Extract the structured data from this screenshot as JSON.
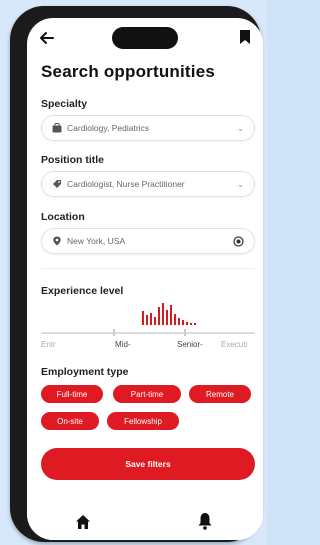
{
  "header": {
    "title": "Search opportunities"
  },
  "specialty": {
    "label": "Specialty",
    "value": "Cardiology, Pediatrics"
  },
  "position": {
    "label": "Position title",
    "value": "Cardiologist, Nurse Practitioner"
  },
  "location": {
    "label": "Location",
    "value": "New York, USA"
  },
  "experience": {
    "label": "Experience level",
    "levels": [
      "Entr",
      "Mid-",
      "Senior-",
      "Executi"
    ]
  },
  "employment": {
    "label": "Employment type",
    "options": [
      "Full-time",
      "Part-time",
      "Remote",
      "On-site",
      "Fellowship"
    ]
  },
  "actions": {
    "save_label": "Save filters"
  },
  "icons": {
    "back": "arrow-left-icon",
    "bookmark": "bookmark-icon",
    "specialty": "briefcase-icon",
    "position": "tag-icon",
    "location": "map-pin-icon",
    "locate": "target-icon",
    "home": "home-icon",
    "notifications": "bell-icon"
  },
  "colors": {
    "accent": "#e01a22",
    "background": "#d6e8fa"
  }
}
